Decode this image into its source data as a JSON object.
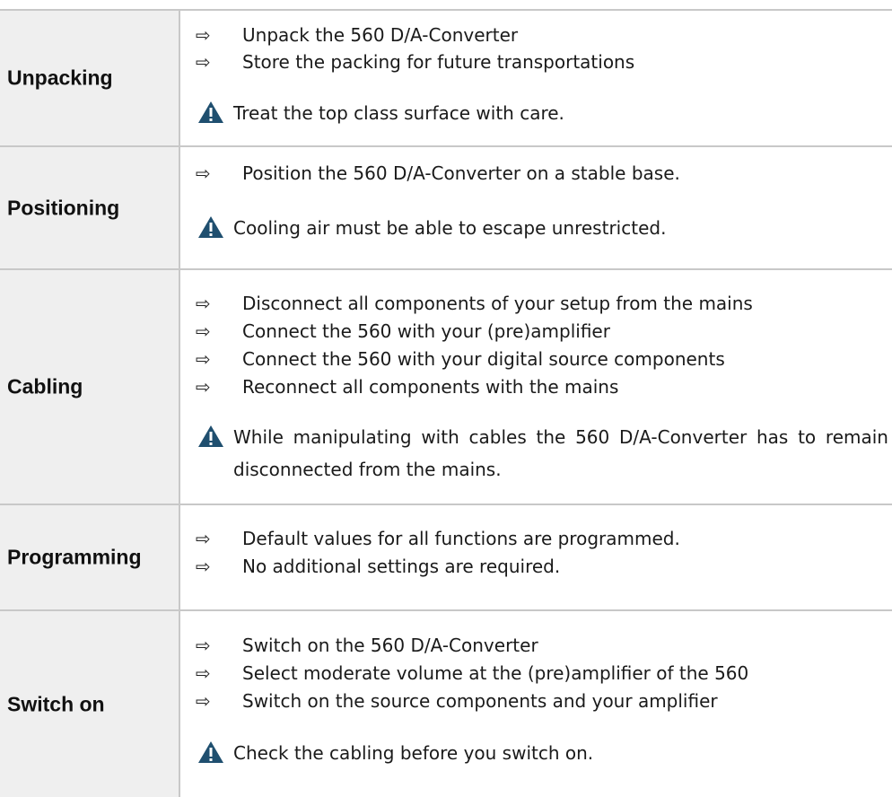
{
  "sections": [
    {
      "label": "Unpacking",
      "items": [
        "Unpack the 560 D/A-Converter",
        "Store the packing for future transportations"
      ],
      "warning": "Treat the top class surface with care."
    },
    {
      "label": "Positioning",
      "items": [
        "Position the 560 D/A-Converter on a stable base."
      ],
      "warning": "Cooling air must be able to escape unrestricted."
    },
    {
      "label": "Cabling",
      "items": [
        "Disconnect all components of your setup from the mains",
        "Connect the 560 with your (pre)amplifier",
        "Connect the 560 with your digital source components",
        "Reconnect all components with the mains"
      ],
      "warning": "While manipulating with cables the 560 D/A-Converter has to remain disconnected from the mains."
    },
    {
      "label": "Programming",
      "items": [
        "Default values for all functions are programmed.",
        "No additional settings are required."
      ],
      "warning": ""
    },
    {
      "label": "Switch on",
      "items": [
        "Switch on the 560 D/A-Converter",
        "Select moderate volume at the (pre)amplifier of the 560",
        "Switch on the source components and your amplifier"
      ],
      "warning": "Check the cabling before you switch on."
    }
  ],
  "icons": {
    "bullet": "arrow-right-icon",
    "warning": "warning-triangle-icon"
  },
  "colors": {
    "warning_icon": "#1f4f6f",
    "label_background": "#efefef",
    "border": "#c8c8c8"
  }
}
